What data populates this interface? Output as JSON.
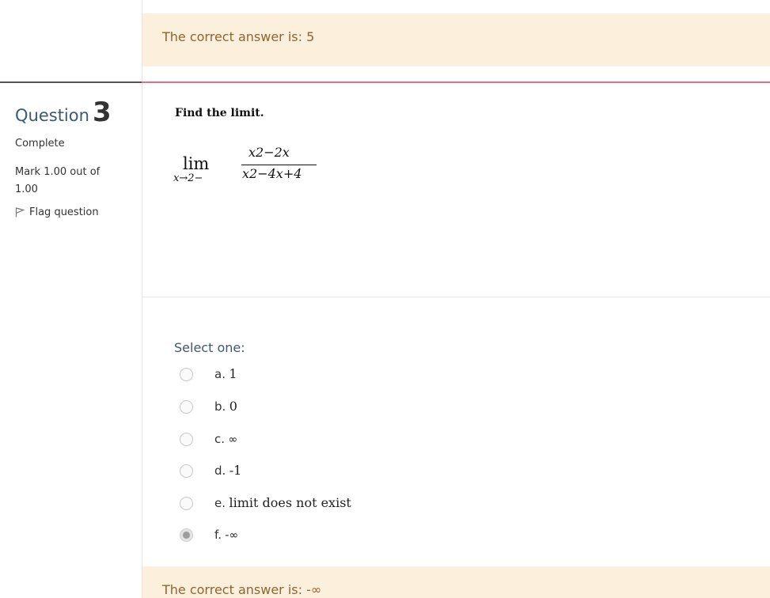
{
  "previous_feedback": "The correct answer is: 5",
  "question": {
    "label": "Question",
    "number": "3",
    "state": "Complete",
    "mark": "Mark 1.00 out of 1.00",
    "flag": "Flag question",
    "text": "Find the limit.",
    "math": {
      "operator": "lim",
      "subscript": "x→2−",
      "numerator": "x2−2x",
      "denominator": "x2−4x+4"
    }
  },
  "select_prompt": "Select one:",
  "options": [
    {
      "letter": "a.",
      "value": "1",
      "checked": false
    },
    {
      "letter": "b.",
      "value": "0",
      "checked": false
    },
    {
      "letter": "c.",
      "value": "∞",
      "checked": false
    },
    {
      "letter": "d.",
      "value": "-1",
      "checked": false
    },
    {
      "letter": "e.",
      "value": "limit does not exist",
      "checked": false
    },
    {
      "letter": "f.",
      "value": "-∞",
      "checked": true
    }
  ],
  "feedback": "The correct answer is: -∞",
  "colors": {
    "feedback_bg": "#fcefdc",
    "feedback_text": "#8e662e",
    "divider_accent": "#ea6a84",
    "heading_blue": "#3b5a73"
  }
}
